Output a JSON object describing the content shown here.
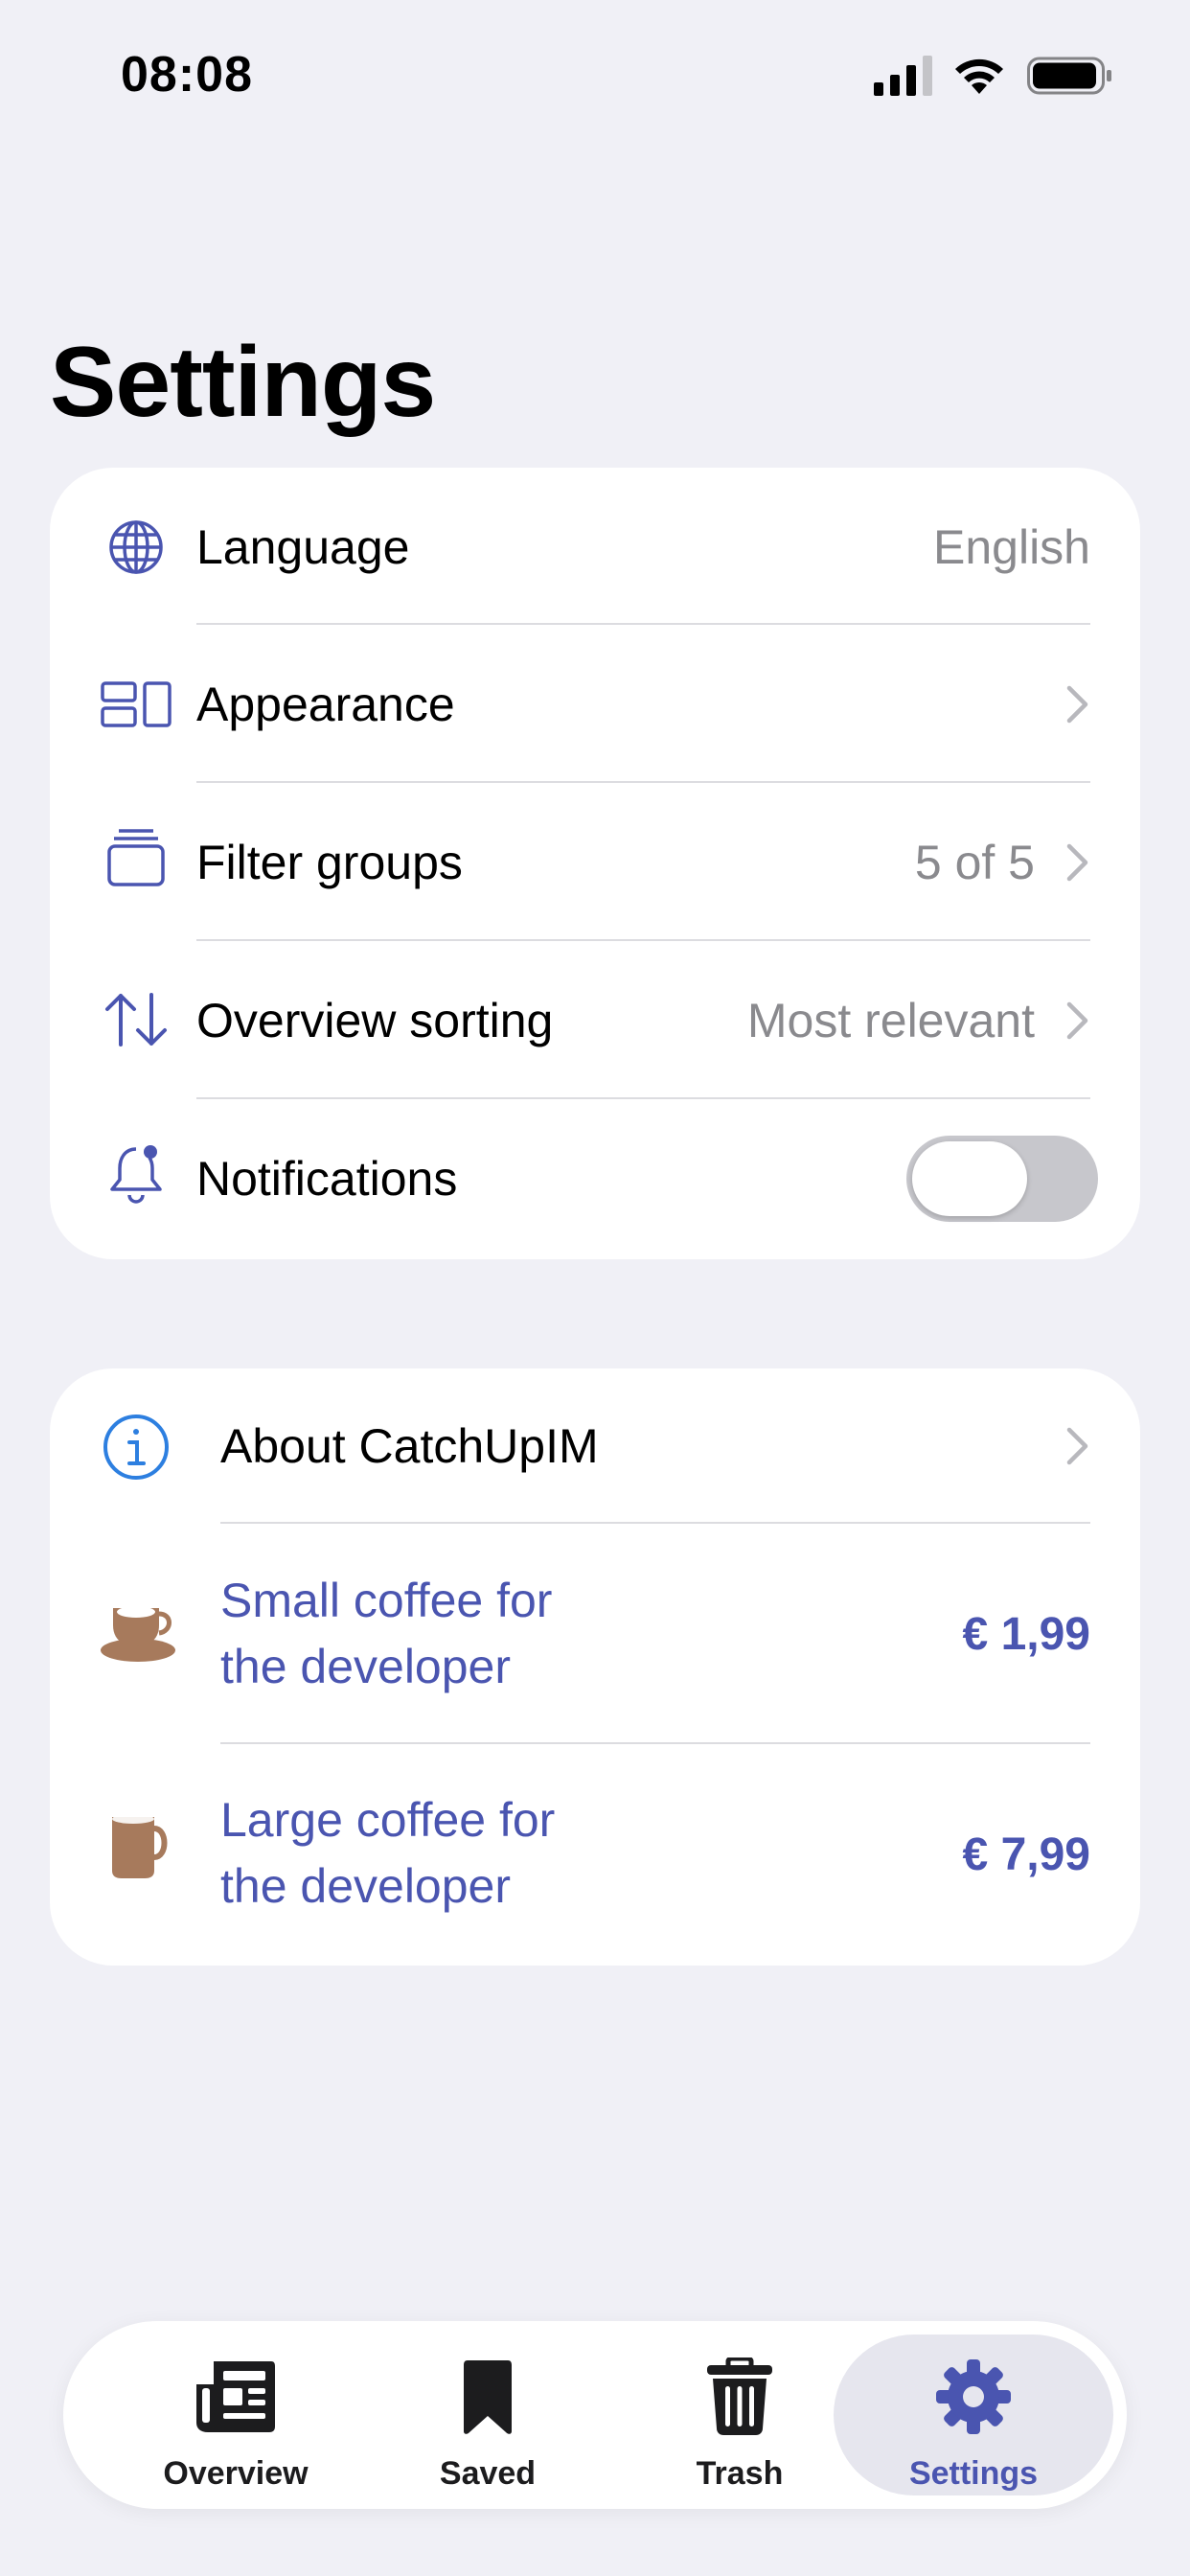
{
  "status_bar": {
    "time": "08:08"
  },
  "page_title": "Settings",
  "settings_group": {
    "language": {
      "label": "Language",
      "value": "English",
      "icon": "globe-icon"
    },
    "appearance": {
      "label": "Appearance",
      "icon": "layout-icon"
    },
    "filter_groups": {
      "label": "Filter groups",
      "value": "5 of 5",
      "icon": "stack-icon"
    },
    "overview_sorting": {
      "label": "Overview sorting",
      "value": "Most relevant",
      "icon": "sort-arrows-icon"
    },
    "notifications": {
      "label": "Notifications",
      "enabled": false,
      "icon": "bell-badge-icon"
    }
  },
  "about_group": {
    "about": {
      "label": "About CatchUpIM",
      "icon": "info-icon"
    },
    "small_coffee": {
      "label_line1": "Small coffee for",
      "label_line2": "the developer",
      "price": "€ 1,99",
      "icon": "coffee-cup-icon"
    },
    "large_coffee": {
      "label_line1": "Large coffee for",
      "label_line2": "the developer",
      "price": "€ 7,99",
      "icon": "mug-icon"
    }
  },
  "tabbar": {
    "tabs": [
      {
        "label": "Overview",
        "icon": "newspaper-icon"
      },
      {
        "label": "Saved",
        "icon": "bookmark-icon"
      },
      {
        "label": "Trash",
        "icon": "trash-icon"
      },
      {
        "label": "Settings",
        "icon": "gear-icon",
        "active": true
      }
    ]
  },
  "colors": {
    "accent": "#4a55b0",
    "coffee": "#a77a5c",
    "background": "#f0f0f6",
    "secondary_text": "#8a8a8e"
  }
}
